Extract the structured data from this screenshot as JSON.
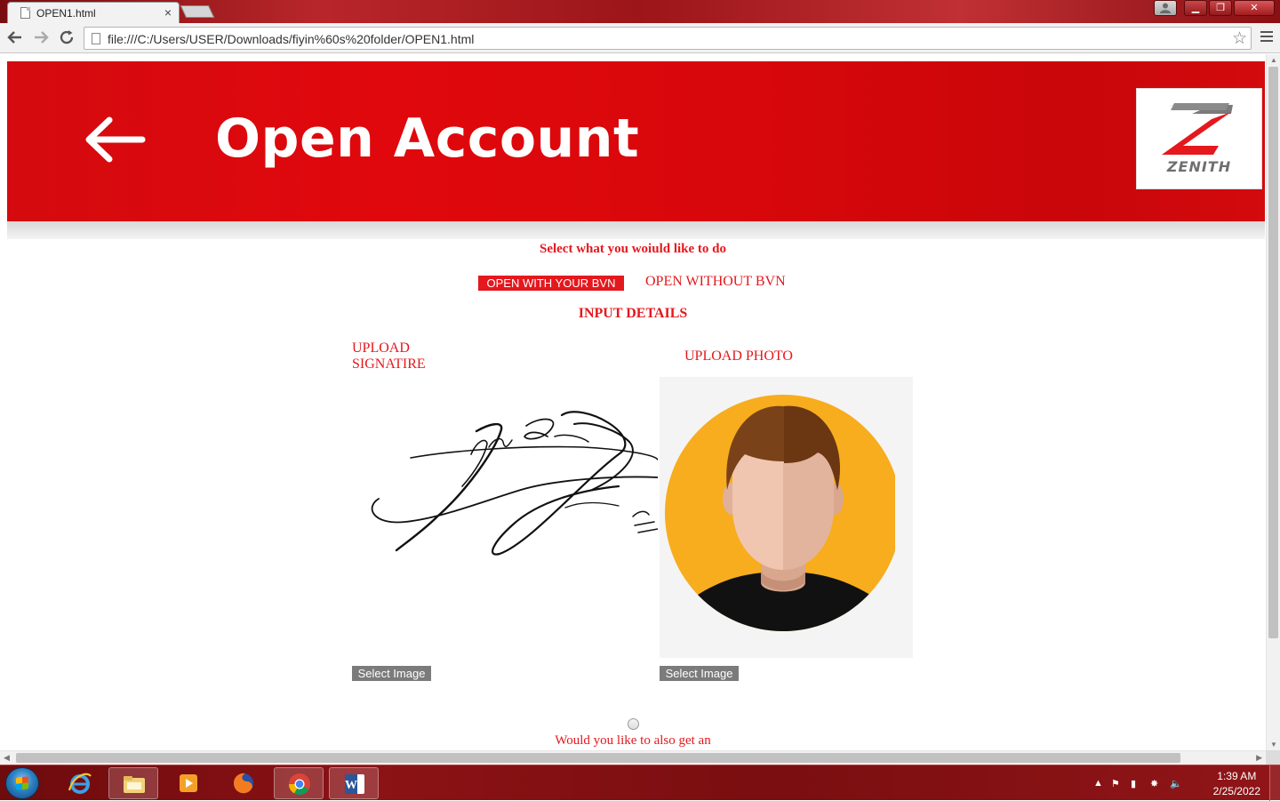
{
  "browser": {
    "tab_title": "OPEN1.html",
    "tab_close": "×",
    "url": "file:///C:/Users/USER/Downloads/fiyin%60s%20folder/OPEN1.html",
    "window_buttons": {
      "minimize": "▁",
      "maximize": "❐",
      "close": "✕",
      "user": "👤"
    }
  },
  "banner": {
    "title": "Open Account",
    "logo_text": "ZENITH",
    "color": "#d40a0f"
  },
  "content": {
    "select_heading": "Select what you woiuld like to do",
    "open_with_bvn": "OPEN WITH YOUR BVN",
    "open_without_bvn": "OPEN WITHOUT BVN",
    "input_details": "INPUT DETAILS",
    "upload_signature": "UPLOAD SIGNATIRE",
    "upload_photo": "UPLOAD PHOTO",
    "select_image_sig": "Select Image",
    "select_image_photo": "Select Image",
    "extra_question": "Would you like to also get an"
  },
  "taskbar": {
    "apps": [
      "internet-explorer",
      "file-explorer",
      "media-player",
      "firefox",
      "chrome",
      "word"
    ],
    "active_app": "chrome",
    "clock_time": "1:39 AM",
    "clock_date": "2/25/2022"
  },
  "colors": {
    "accent_red": "#e4181d",
    "button_gray": "#7b7b7b"
  }
}
